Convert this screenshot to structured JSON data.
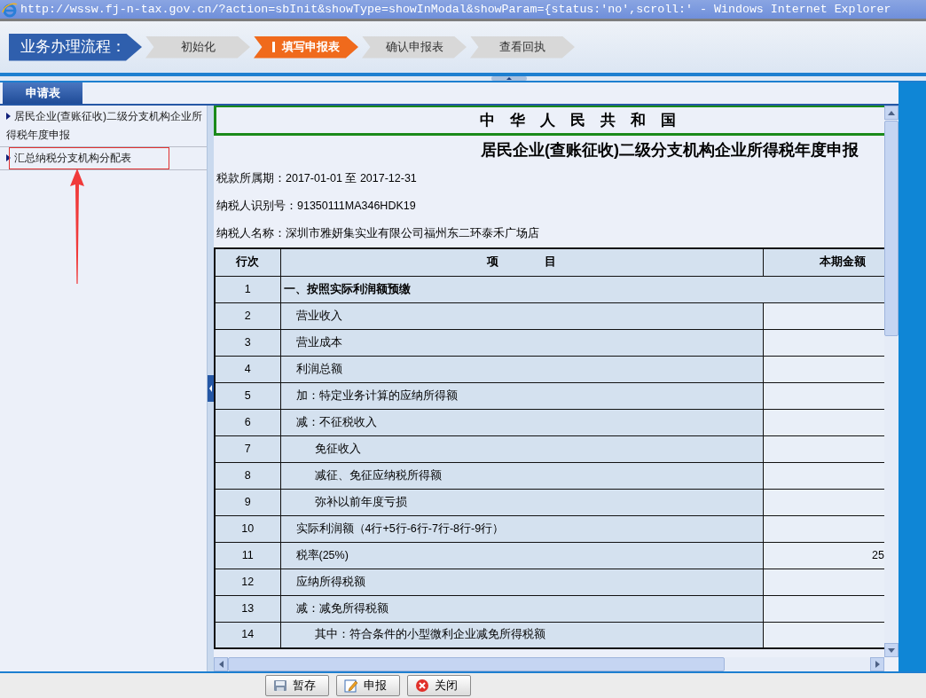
{
  "window": {
    "title": "http://wssw.fj-n-tax.gov.cn/?action=sbInit&showType=showInModal&showParam={status:'no',scroll:' - Windows Internet Explorer"
  },
  "process": {
    "label": "业务办理流程：",
    "steps": [
      {
        "label": "初始化",
        "selected": false
      },
      {
        "label": "填写申报表",
        "selected": true
      },
      {
        "label": "确认申报表",
        "selected": false
      },
      {
        "label": "查看回执",
        "selected": false
      }
    ]
  },
  "tabs": [
    {
      "label": "申请表",
      "selected": true
    }
  ],
  "sidebar": {
    "items": [
      {
        "label": "居民企业(查账征收)二级分支机构企业所得税年度申报",
        "highlighted": false
      },
      {
        "label": "汇总纳税分支机构分配表",
        "highlighted": true
      }
    ]
  },
  "form": {
    "country": "中　华　人　民　共　和　国",
    "title": "居民企业(查账征收)二级分支机构企业所得税年度申报",
    "fields": [
      {
        "label": "税款所属期：",
        "value": "2017-01-01 至 2017-12-31"
      },
      {
        "label": "纳税人识别号：",
        "value": "91350111MA346HDK19"
      },
      {
        "label": "纳税人名称：",
        "value": "深圳市雅妍集实业有限公司福州东二环泰禾广场店"
      }
    ],
    "table": {
      "columns": [
        "行次",
        "项　　　　目",
        "本期金额"
      ],
      "rows": [
        {
          "line": "1",
          "item": "一、按照实际利润额预缴",
          "kind": "section"
        },
        {
          "line": "2",
          "item": "营业收入",
          "kind": "item"
        },
        {
          "line": "3",
          "item": "营业成本",
          "kind": "item"
        },
        {
          "line": "4",
          "item": "利润总额",
          "kind": "item"
        },
        {
          "line": "5",
          "item": "加：特定业务计算的应纳所得额",
          "kind": "item"
        },
        {
          "line": "6",
          "item": "减：不征税收入",
          "kind": "item"
        },
        {
          "line": "7",
          "item": "免征收入",
          "kind": "subitem"
        },
        {
          "line": "8",
          "item": "减征、免征应纳税所得额",
          "kind": "subitem"
        },
        {
          "line": "9",
          "item": "弥补以前年度亏损",
          "kind": "subitem"
        },
        {
          "line": "10",
          "item": "实际利润额（4行+5行-6行-7行-8行-9行）",
          "kind": "item"
        },
        {
          "line": "11",
          "item": "税率(25%)",
          "kind": "item",
          "amount": "25"
        },
        {
          "line": "12",
          "item": "应纳所得税额",
          "kind": "item"
        },
        {
          "line": "13",
          "item": "减：减免所得税额",
          "kind": "item"
        },
        {
          "line": "14",
          "item": "其中：符合条件的小型微利企业减免所得税额",
          "kind": "subitem"
        }
      ]
    }
  },
  "buttons": [
    {
      "label": "暂存",
      "kind": "save"
    },
    {
      "label": "申报",
      "kind": "submit"
    },
    {
      "label": "关闭",
      "kind": "close"
    }
  ]
}
